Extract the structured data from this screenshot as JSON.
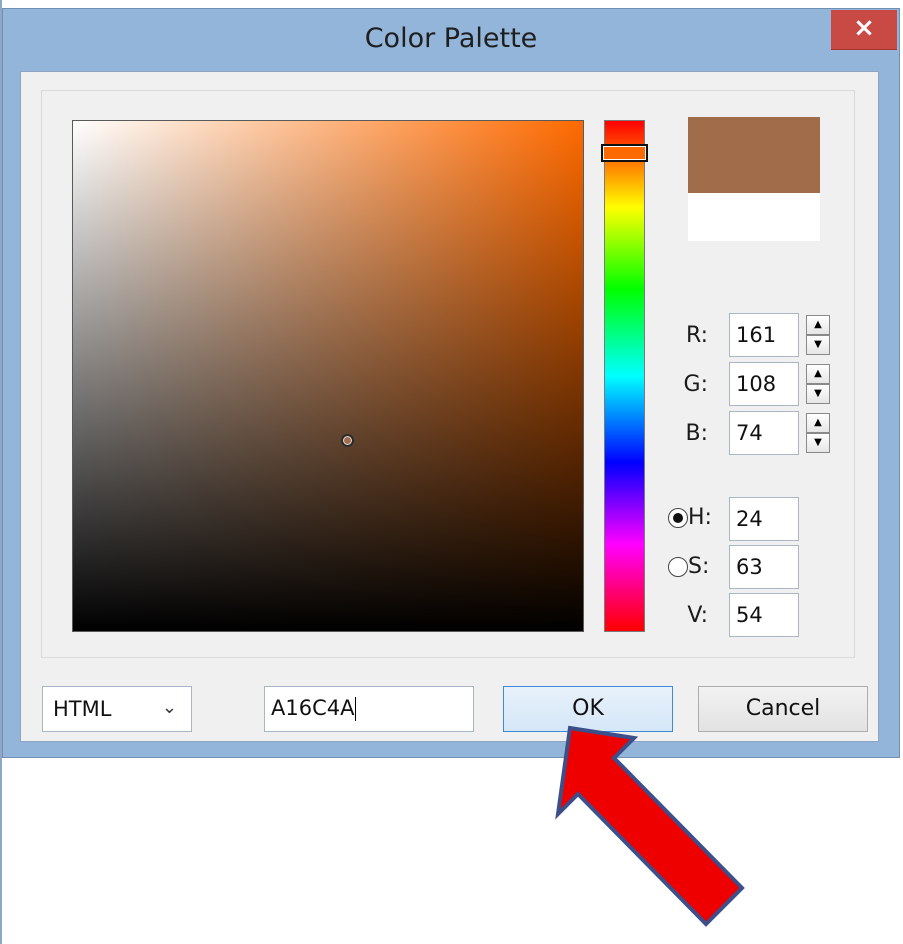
{
  "window": {
    "title": "Color Palette",
    "close_glyph": "×"
  },
  "colors": {
    "selected": "#a16c4a",
    "previous": "#ffffff",
    "hue_base": "#ff6a00",
    "annotation_arrow": "#ee0000"
  },
  "rgb": {
    "r_label": "R:",
    "r_value": "161",
    "g_label": "G:",
    "g_value": "108",
    "b_label": "B:",
    "b_value": "74"
  },
  "hsv": {
    "h_label": "H:",
    "h_value": "24",
    "s_label": "S:",
    "s_value": "63",
    "v_label": "V:",
    "v_value": "54",
    "selected_mode": "H"
  },
  "format": {
    "selected": "HTML",
    "chevron": "⌄"
  },
  "hex": {
    "value": "A16C4A"
  },
  "buttons": {
    "ok": "OK",
    "cancel": "Cancel"
  },
  "spinner": {
    "up": "▲",
    "down": "▼"
  },
  "icons": {
    "close": "close-icon",
    "spinner_up": "triangle-up-icon",
    "spinner_down": "triangle-down-icon",
    "dropdown": "chevron-down-icon",
    "annotation": "red-arrow-pointer"
  }
}
